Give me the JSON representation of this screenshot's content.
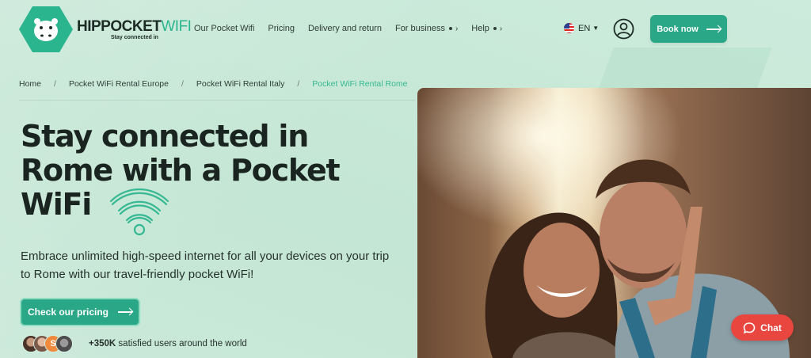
{
  "brand": {
    "name_main": "HIPPOCKET",
    "name_accent": "WIFI",
    "tagline": "Stay connected in"
  },
  "nav": {
    "items": [
      {
        "label": "Our Pocket Wifi"
      },
      {
        "label": "Pricing"
      },
      {
        "label": "Delivery and return"
      },
      {
        "label": "For business"
      },
      {
        "label": "Help"
      }
    ],
    "language": "EN",
    "book_label": "Book now"
  },
  "breadcrumb": [
    "Home",
    "Pocket WiFi Rental Europe",
    "Pocket WiFi Rental Italy",
    "Pocket WiFi Rental Rome"
  ],
  "hero": {
    "title": "Stay connected in Rome with a Pocket WiFi",
    "description": "Embrace unlimited high-speed internet for all your devices on your trip to Rome with our travel-friendly pocket WiFi!",
    "cta_label": "Check our pricing",
    "users_count": "+350K",
    "users_text": "satisfied users around the world",
    "avatar_letter": "S"
  },
  "chat": {
    "label": "Chat"
  },
  "colors": {
    "accent": "#2aa786",
    "background": "#d2eee0",
    "chat": "#e8463f",
    "breadcrumb_active": "#35b893"
  }
}
